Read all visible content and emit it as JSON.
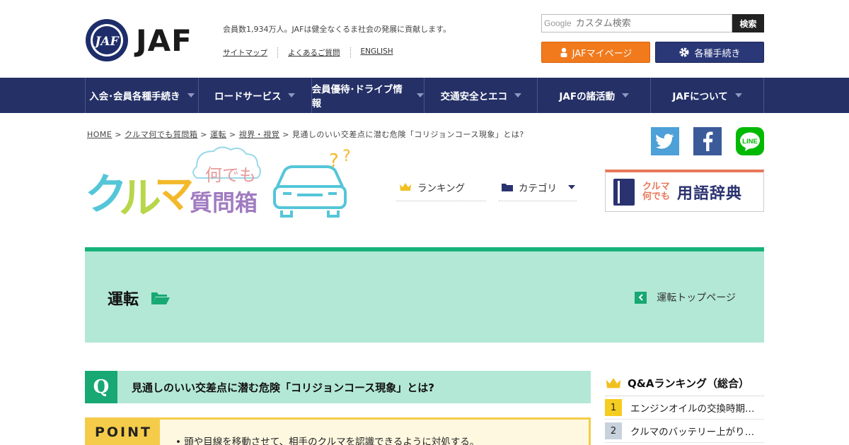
{
  "header": {
    "logo_text": "JAF",
    "tagline": "会員数1,934万人。JAFは健全なくるま社会の発展に貢献します。",
    "sublinks": [
      "サイトマップ",
      "よくあるご質問",
      "ENGLISH"
    ],
    "search": {
      "brand": "Google",
      "placeholder": "カスタム検索",
      "button": "検索"
    },
    "mypage_button": "JAFマイページ",
    "procedures_button": "各種手続き"
  },
  "nav": {
    "items": [
      "入会･会員各種手続き",
      "ロードサービス",
      "会員優待･ドライブ情報",
      "交通安全とエコ",
      "JAFの諸活動",
      "JAFについて"
    ]
  },
  "breadcrumb": {
    "items": [
      "HOME",
      "クルマ何でも質問箱",
      "運転",
      "視界・視覚"
    ],
    "current": "見通しのいい交差点に潜む危険「コリジョンコース現象」とは?"
  },
  "site": {
    "menu": {
      "ranking": "ランキング",
      "category": "カテゴリ"
    },
    "dictionary": {
      "small_1": "クルマ",
      "small_2": "何でも",
      "big": "用語辞典"
    }
  },
  "category": {
    "title": "運転",
    "top_link": "運転トップページ"
  },
  "question": {
    "mark": "Q",
    "text": "見通しのいい交差点に潜む危険「コリジョンコース現象」とは?",
    "point_label": "POINT",
    "point_text": "頭や目線を移動させて、相手のクルマを認識できるように対処する。"
  },
  "ranking": {
    "title": "Q&Aランキング（総合）",
    "items": [
      {
        "num": "1",
        "text": "エンジンオイルの交換時期…"
      },
      {
        "num": "2",
        "text": "クルマのバッテリー上がり…"
      }
    ]
  },
  "colors": {
    "nav_bg": "#243066",
    "accent_green": "#17b27a",
    "band_bg": "#b3e8d6",
    "mypage_orange": "#f07a1c",
    "point_yellow": "#f5cc4a"
  }
}
